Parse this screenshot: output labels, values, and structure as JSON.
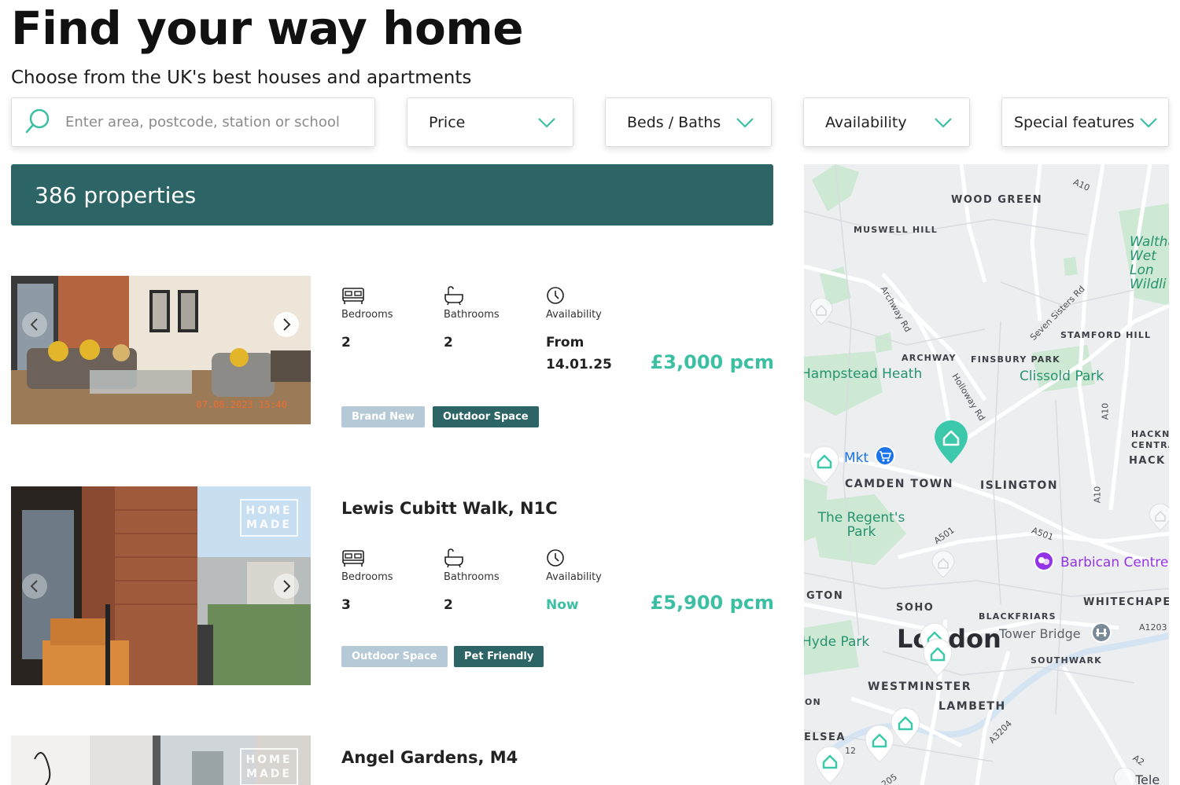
{
  "header": {
    "title": "Find your way home",
    "subtitle": "Choose from the UK's best houses and apartments"
  },
  "search": {
    "placeholder": "Enter area, postcode, station or school",
    "value": ""
  },
  "filters": [
    {
      "label": "Price"
    },
    {
      "label": "Beds / Baths"
    },
    {
      "label": "Availability"
    },
    {
      "label": "Special features"
    }
  ],
  "results": {
    "count_label": "386 properties"
  },
  "listings": [
    {
      "title": "",
      "specs": {
        "bedrooms_label": "Bedrooms",
        "bedrooms": "2",
        "bathrooms_label": "Bathrooms",
        "bathrooms": "2",
        "availability_label": "Availability",
        "availability_line1": "From",
        "availability_line2": "14.01.25"
      },
      "price": "£3,000 pcm",
      "tags": [
        "Brand New",
        "Outdoor Space"
      ],
      "photo_stamp": "07.08.2023 15:40"
    },
    {
      "title": "Lewis Cubitt Walk, N1C",
      "specs": {
        "bedrooms_label": "Bedrooms",
        "bedrooms": "3",
        "bathrooms_label": "Bathrooms",
        "bathrooms": "2",
        "availability_label": "Availability",
        "availability": "Now"
      },
      "price": "£5,900 pcm",
      "tags": [
        "Outdoor Space",
        "Pet Friendly"
      ],
      "watermark": "HOME MADE"
    },
    {
      "title": "Angel Gardens, M4",
      "watermark": "HOME MADE"
    }
  ],
  "map": {
    "areas": [
      "WOOD GREEN",
      "MUSWELL HILL",
      "STAMFORD HILL",
      "ARCHWAY",
      "FINSBURY PARK",
      "CAMDEN TOWN",
      "ISLINGTON",
      "SOHO",
      "WHITECHAPE",
      "BLACKFRIARS",
      "SOUTHWARK",
      "WESTMINSTER",
      "LAMBETH",
      "GTON",
      "ON",
      "ELSEA",
      "HACKNE",
      "CENTRA",
      "HACK"
    ],
    "parks": [
      "Hampstead Heath",
      "Clissold Park",
      "The Regent's Park",
      "Hyde Park",
      "Waltham Wet Lon Wildli"
    ],
    "roads": [
      "A10",
      "Archway Rd",
      "Seven Sisters Rd",
      "Holloway Rd",
      "A10",
      "A10",
      "A501",
      "A501",
      "A1203",
      "A3204",
      "A2",
      "12",
      "205"
    ],
    "city": "London",
    "pois": [
      "Mkt",
      "Barbican Centre",
      "Tower Bridge",
      "Tele"
    ]
  },
  "colors": {
    "accent": "#3cbfa3",
    "bar": "#2d6466",
    "tag_grey": "#b6c9d6"
  },
  "icons": [
    "search-icon",
    "chevron-down-icon",
    "bed-icon",
    "bath-icon",
    "clock-icon",
    "chevron-left-icon",
    "chevron-right-icon",
    "home-pin-icon",
    "cart-icon",
    "theatre-icon",
    "bridge-icon"
  ]
}
